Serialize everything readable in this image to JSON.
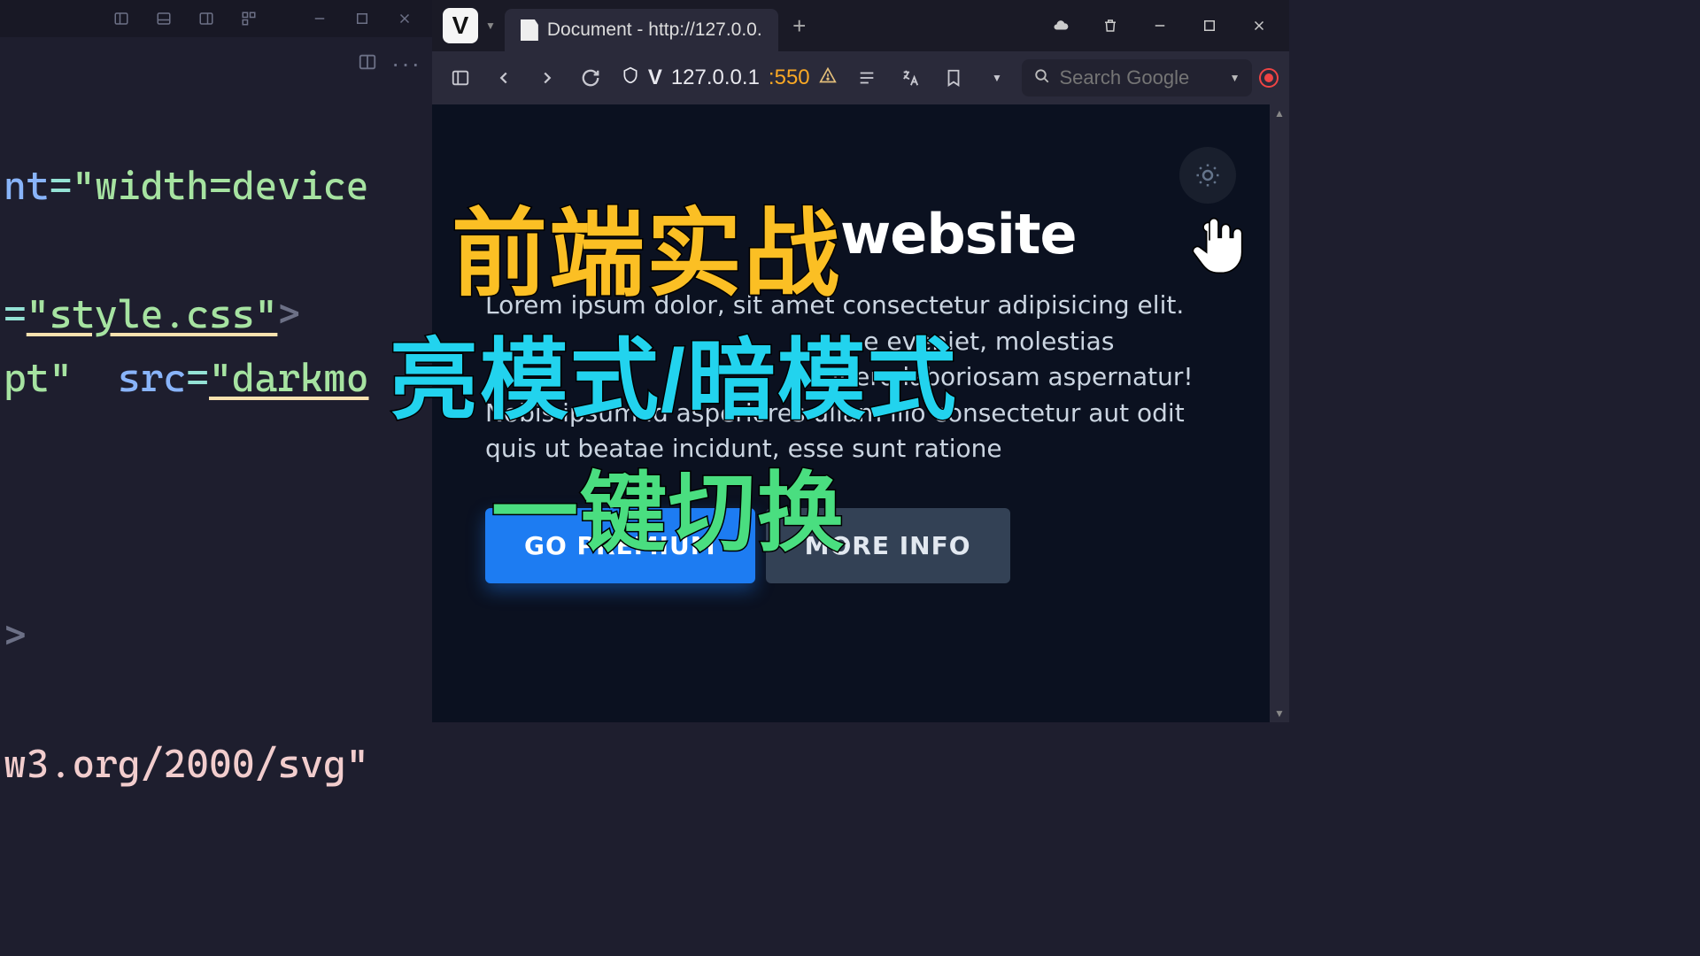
{
  "editor": {
    "code_line1_attr": "nt",
    "code_line1_eq": "=",
    "code_line1_str": "\"width=device",
    "code_line2_eq": "=",
    "code_line2_str": "\"style.css\"",
    "code_line2_punc": ">",
    "code_line3_pt": "pt\"",
    "code_line3_src": "src",
    "code_line3_eq": "=",
    "code_line3_str": "\"darkmo",
    "code_line4_punc": ">",
    "code_line5_text": "w3.org/2000/svg\""
  },
  "browser": {
    "tab_title": "Document - http://127.0.0.",
    "address": "127.0.0.1",
    "address_port": ":550",
    "search_placeholder": "Search Google"
  },
  "page": {
    "title_word": "website",
    "paragraph": "Lorem ipsum dolor, sit amet consectetur adipisicing elit.                                                 e eveniet, molestias                                             ibero laboriosam aspernatur! Nobis ipsum id asperiores ullam illo consectetur aut odit quis ut beatae incidunt, esse sunt ratione",
    "btn_primary": "GO PREMIUM",
    "btn_secondary": "MORE INFO"
  },
  "overlay": {
    "line1": "前端实战",
    "line2": "亮模式/暗模式",
    "line3": "一键切换"
  }
}
